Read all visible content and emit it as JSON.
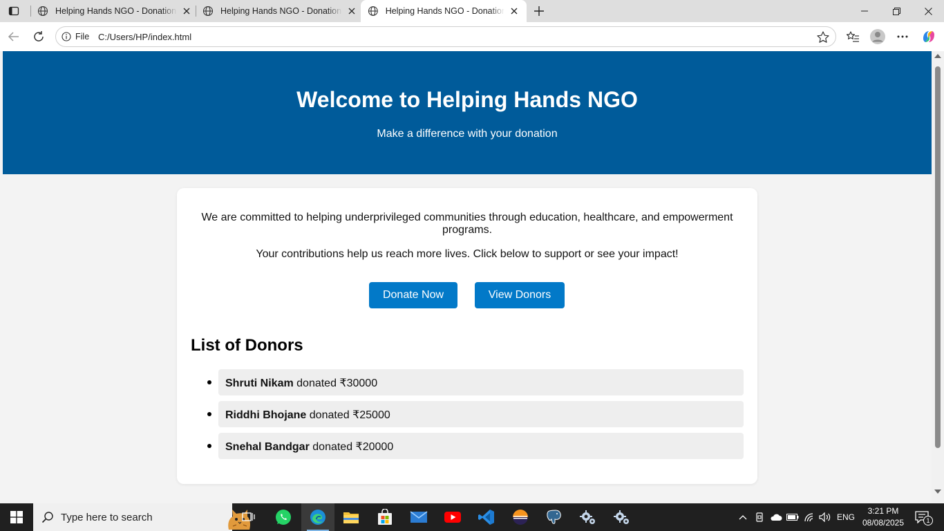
{
  "browser": {
    "tabs": [
      {
        "title": "Helping Hands NGO - Donation Page",
        "active": false
      },
      {
        "title": "Helping Hands NGO - Donation Page",
        "active": false
      },
      {
        "title": "Helping Hands NGO - Donation Page",
        "active": true
      }
    ],
    "address": {
      "scheme": "File",
      "url": "C:/Users/HP/index.html"
    }
  },
  "page": {
    "hero": {
      "title": "Welcome to Helping Hands NGO",
      "subtitle": "Make a difference with your donation"
    },
    "mission": "We are committed to helping underprivileged communities through education, healthcare, and empowerment programs.",
    "cta_text": "Your contributions help us reach more lives. Click below to support or see your impact!",
    "buttons": {
      "donate": "Donate Now",
      "view": "View Donors"
    },
    "donors_title": "List of Donors",
    "donors": [
      {
        "name": "Shruti Nikam",
        "text": "donated ₹30000"
      },
      {
        "name": "Riddhi Bhojane",
        "text": "donated ₹25000"
      },
      {
        "name": "Snehal Bandgar",
        "text": "donated ₹20000"
      }
    ],
    "colors": {
      "header": "#005b9a",
      "button": "#0279c8",
      "donor_row": "#eeeeee"
    }
  },
  "taskbar": {
    "search_placeholder": "Type here to search",
    "apps": [
      "task-view",
      "whatsapp",
      "edge",
      "file-explorer",
      "microsoft-store",
      "mail",
      "youtube",
      "vscode",
      "eclipse",
      "postgresql",
      "settings",
      "settings"
    ],
    "tray": {
      "language": "ENG",
      "time": "3:21 PM",
      "date": "08/08/2025",
      "notifications": "1"
    }
  }
}
